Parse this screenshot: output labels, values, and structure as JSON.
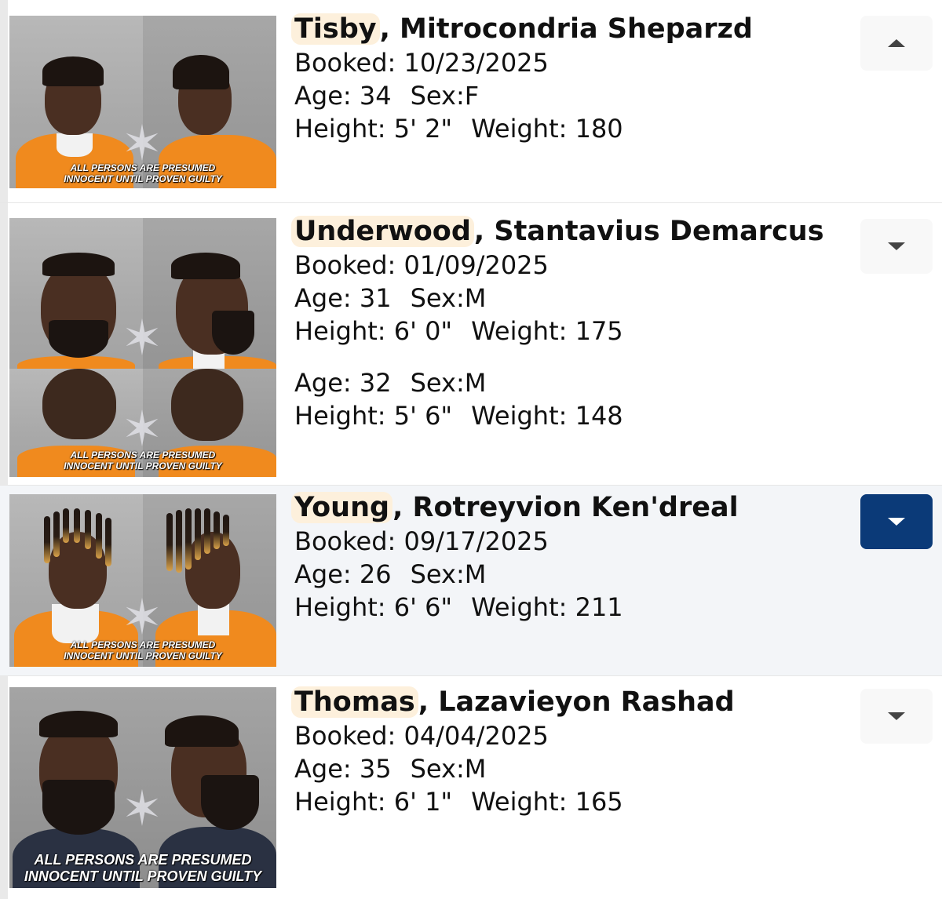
{
  "records": [
    {
      "last_name": "Tisby",
      "first_names": ", Mitrocondria Sheparzd",
      "booked_label": "Booked:",
      "booked": "10/23/2025",
      "age_label": "Age:",
      "age": "34",
      "sex_label": "Sex:",
      "sex": "F",
      "height_label": "Height:",
      "height": "5' 2\"",
      "weight_label": "Weight:",
      "weight": "180",
      "disclaimer_line1": "ALL PERSONS ARE PRESUMED",
      "disclaimer_line2": "INNOCENT UNTIL PROVEN GUILTY",
      "toggle_icon": "chevron-up-icon",
      "expanded": true
    },
    {
      "last_name": "Underwood",
      "first_names": ", Stantavius Demarcus",
      "booked_label": "Booked:",
      "booked": "01/09/2025",
      "age_label": "Age:",
      "age": "31",
      "sex_label": "Sex:",
      "sex": "M",
      "height_label": "Height:",
      "height": "6' 0\"",
      "weight_label": "Weight:",
      "weight": "175",
      "age2": "32",
      "sex2": "M",
      "height2": "5' 6\"",
      "weight2": "148",
      "disclaimer_line1": "ALL PERSONS ARE PRESUMED",
      "disclaimer_line2": "INNOCENT UNTIL PROVEN GUILTY",
      "toggle_icon": "chevron-down-icon",
      "expanded": false
    },
    {
      "last_name": "Young",
      "first_names": ", Rotreyvion Ken'dreal",
      "booked_label": "Booked:",
      "booked": "09/17/2025",
      "age_label": "Age:",
      "age": "26",
      "sex_label": "Sex:",
      "sex": "M",
      "height_label": "Height:",
      "height": "6' 6\"",
      "weight_label": "Weight:",
      "weight": "211",
      "disclaimer_line1": "ALL PERSONS ARE PRESUMED",
      "disclaimer_line2": "INNOCENT UNTIL PROVEN GUILTY",
      "toggle_icon": "chevron-down-icon",
      "expanded": false,
      "selected": true
    },
    {
      "last_name": "Thomas",
      "first_names": ", Lazavieyon Rashad",
      "booked_label": "Booked:",
      "booked": "04/04/2025",
      "age_label": "Age:",
      "age": "35",
      "sex_label": "Sex:",
      "sex": "M",
      "height_label": "Height:",
      "height": "6' 1\"",
      "weight_label": "Weight:",
      "weight": "165",
      "disclaimer_line1": "ALL PERSONS ARE PRESUMED",
      "disclaimer_line2": "INNOCENT UNTIL PROVEN GUILTY",
      "toggle_icon": "chevron-down-icon",
      "expanded": false
    }
  ],
  "colors": {
    "selected_row_bg": "#f3f5f8",
    "active_toggle": "#0b3a78",
    "last_name_highlight": "#fdf0dc",
    "jumpsuit": "#f08a1e"
  }
}
